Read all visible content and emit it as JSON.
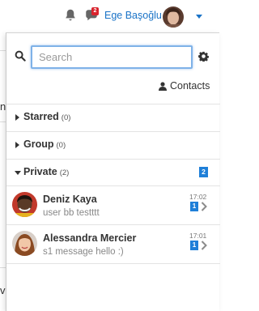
{
  "topbar": {
    "notification_count": "2",
    "username": "Ege Başoğlu"
  },
  "background_fragments": [
    "ne",
    "va"
  ],
  "panel": {
    "search": {
      "placeholder": "Search",
      "value": ""
    },
    "contacts_label": "Contacts",
    "sections": [
      {
        "title": "Starred",
        "count": "(0)",
        "expanded": false
      },
      {
        "title": "Group",
        "count": "(0)",
        "expanded": false
      },
      {
        "title": "Private",
        "count": "(2)",
        "expanded": true,
        "unread": "2"
      }
    ],
    "contacts": [
      {
        "name": "Deniz Kaya",
        "message": "user bb testttt",
        "time": "17:02",
        "unread": "1"
      },
      {
        "name": "Alessandra Mercier",
        "message": "s1 message hello :)",
        "time": "17:01",
        "unread": "1"
      }
    ]
  },
  "colors": {
    "accent": "#1a73c7",
    "badge_blue": "#1f7fd8",
    "badge_red": "#d9232d",
    "search_focus": "#7fb2e8"
  },
  "icons": [
    "bell-icon",
    "chat-icon",
    "search-icon",
    "gear-icon",
    "user-icon",
    "caret-right-icon",
    "caret-down-icon",
    "chevron-right-icon"
  ]
}
